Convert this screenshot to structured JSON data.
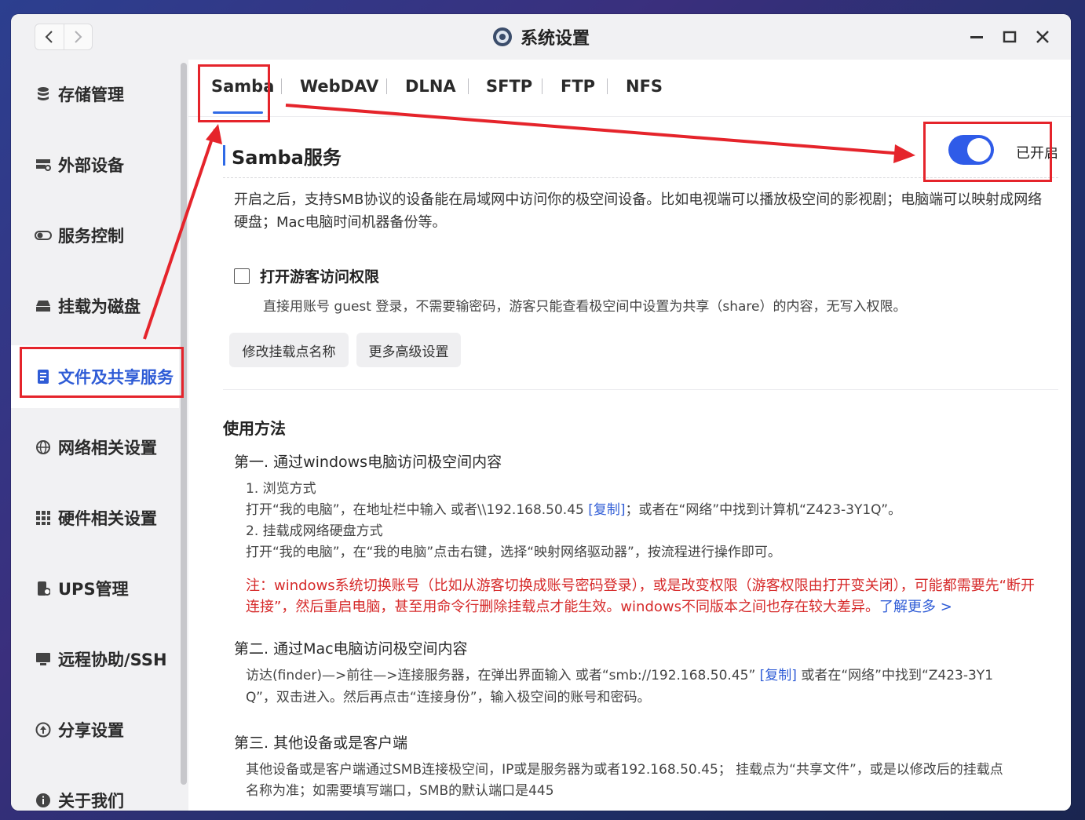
{
  "window": {
    "title": "系统设置",
    "logo_icon": "zspace-logo-icon"
  },
  "sidebar": {
    "items": [
      {
        "label": "存储管理",
        "icon": "database-icon"
      },
      {
        "label": "外部设备",
        "icon": "external-device-icon"
      },
      {
        "label": "服务控制",
        "icon": "toggle-icon"
      },
      {
        "label": "挂载为磁盘",
        "icon": "disk-mount-icon"
      },
      {
        "label": "文件及共享服务",
        "icon": "file-share-icon"
      },
      {
        "label": "网络相关设置",
        "icon": "globe-icon"
      },
      {
        "label": "硬件相关设置",
        "icon": "grid-icon"
      },
      {
        "label": "UPS管理",
        "icon": "ups-icon"
      },
      {
        "label": "远程协助/SSH",
        "icon": "monitor-icon"
      },
      {
        "label": "分享设置",
        "icon": "share-icon"
      },
      {
        "label": "关于我们",
        "icon": "info-icon"
      }
    ],
    "active_label": "文件及共享服务"
  },
  "tabs": [
    "Samba",
    "WebDAV",
    "DLNA",
    "SFTP",
    "FTP",
    "NFS"
  ],
  "active_tab": "Samba",
  "samba": {
    "title": "Samba服务",
    "toggle_on": true,
    "toggle_label": "已开启",
    "description": "开启之后，支持SMB协议的设备能在局域网中访问你的极空间设备。比如电视端可以播放极空间的影视剧；电脑端可以映射成网络硬盘；Mac电脑时间机器备份等。",
    "guest_checkbox": {
      "checked": false,
      "label": "打开游客访问权限",
      "desc": "直接用账号 guest 登录，不需要输密码，游客只能查看极空间中设置为共享（share）的内容，无写入权限。"
    },
    "buttons": {
      "rename": "修改挂载点名称",
      "advanced": "更多高级设置"
    }
  },
  "usage": {
    "title": "使用方法",
    "windows": {
      "heading": "第一. 通过windows电脑访问极空间内容",
      "step1": "1. 浏览方式",
      "step1_text_a": "打开“我的电脑”，在地址栏中输入 或者\\\\192.168.50.45 ",
      "copy": "[复制]",
      "step1_text_b": "；或者在“网络”中找到计算机“Z423-3Y1Q”。",
      "step2": "2. 挂载成网络硬盘方式",
      "step2_text": "打开“我的电脑”，在“我的电脑”点击右键，选择“映射网络驱动器”，按流程进行操作即可。",
      "note_line1": "注：windows系统切换账号（比如从游客切换成账号密码登录），或是改变权限（游客权限由打开变关闭），可能都需要先“断开",
      "note_line2": "连接”，然后重启电脑，甚至用命令行删除挂载点才能生效。windows不同版本之间也存在较大差异。",
      "learn_more": "了解更多 >"
    },
    "mac": {
      "heading": "第二. 通过Mac电脑访问极空间内容",
      "line1_a": "访达(finder)—>前往—>连接服务器，在弹出界面输入 或者“smb://192.168.50.45” ",
      "copy": "[复制]",
      "line1_b": " 或者在“网络”中找到“Z423-3Y1",
      "line2": "Q”，双击进入。然后再点击“连接身份”，输入极空间的账号和密码。"
    },
    "other": {
      "heading": "第三. 其他设备或是客户端",
      "line1": "其他设备或是客户端通过SMB连接极空间，IP或是服务器为或者192.168.50.45； 挂载点为“共享文件”，或是以修改后的挂载点",
      "line2": "名称为准；如需要填写端口，SMB的默认端口是445"
    }
  },
  "colors": {
    "accent": "#2f5be8",
    "annotation_red": "#e5242b",
    "warning_red": "#d62a2a"
  }
}
